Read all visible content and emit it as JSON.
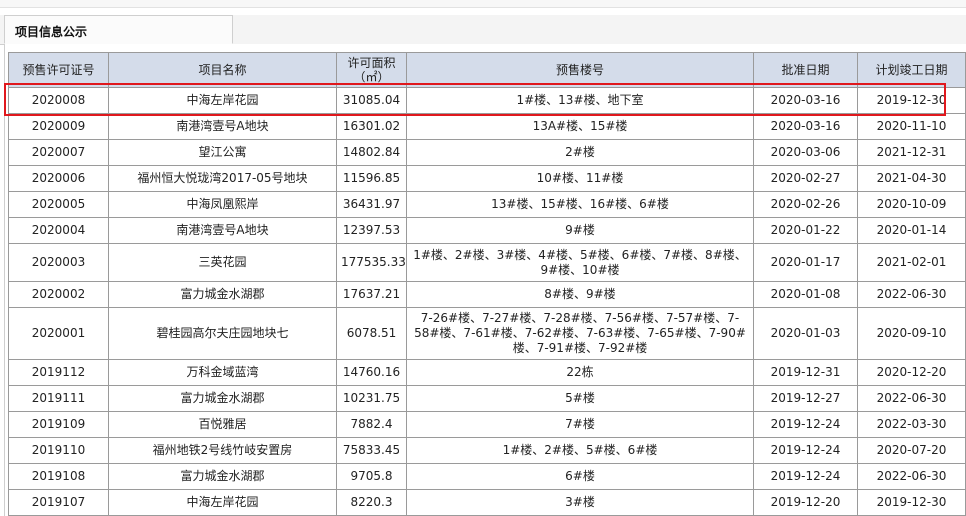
{
  "tab": {
    "label": "项目信息公示"
  },
  "table": {
    "headers": [
      "预售许可证号",
      "项目名称",
      "许可面积（㎡）",
      "预售楼号",
      "批准日期",
      "计划竣工日期"
    ],
    "rows": [
      [
        "2020008",
        "中海左岸花园",
        "31085.04",
        "1#楼、13#楼、地下室",
        "2020-03-16",
        "2019-12-30"
      ],
      [
        "2020009",
        "南港湾壹号A地块",
        "16301.02",
        "13A#楼、15#楼",
        "2020-03-16",
        "2020-11-10"
      ],
      [
        "2020007",
        "望江公寓",
        "14802.84",
        "2#楼",
        "2020-03-06",
        "2021-12-31"
      ],
      [
        "2020006",
        "福州恒大悦珑湾2017-05号地块",
        "11596.85",
        "10#楼、11#楼",
        "2020-02-27",
        "2021-04-30"
      ],
      [
        "2020005",
        "中海凤凰熙岸",
        "36431.97",
        "13#楼、15#楼、16#楼、6#楼",
        "2020-02-26",
        "2020-10-09"
      ],
      [
        "2020004",
        "南港湾壹号A地块",
        "12397.53",
        "9#楼",
        "2020-01-22",
        "2020-01-14"
      ],
      [
        "2020003",
        "三英花园",
        "177535.33",
        "1#楼、2#楼、3#楼、4#楼、5#楼、6#楼、7#楼、8#楼、9#楼、10#楼",
        "2020-01-17",
        "2021-02-01"
      ],
      [
        "2020002",
        "富力城金水湖郡",
        "17637.21",
        "8#楼、9#楼",
        "2020-01-08",
        "2022-06-30"
      ],
      [
        "2020001",
        "碧桂园高尔夫庄园地块七",
        "6078.51",
        "7-26#楼、7-27#楼、7-28#楼、7-56#楼、7-57#楼、7-58#楼、7-61#楼、7-62#楼、7-63#楼、7-65#楼、7-90#楼、7-91#楼、7-92#楼",
        "2020-01-03",
        "2020-09-10"
      ],
      [
        "2019112",
        "万科金域蓝湾",
        "14760.16",
        "22栋",
        "2019-12-31",
        "2020-12-20"
      ],
      [
        "2019111",
        "富力城金水湖郡",
        "10231.75",
        "5#楼",
        "2019-12-27",
        "2022-06-30"
      ],
      [
        "2019109",
        "百悦雅居",
        "7882.4",
        "7#楼",
        "2019-12-24",
        "2022-03-30"
      ],
      [
        "2019110",
        "福州地铁2号线竹岐安置房",
        "75833.45",
        "1#楼、2#楼、5#楼、6#楼",
        "2019-12-24",
        "2020-07-20"
      ],
      [
        "2019108",
        "富力城金水湖郡",
        "9705.8",
        "6#楼",
        "2019-12-24",
        "2022-06-30"
      ],
      [
        "2019107",
        "中海左岸花园",
        "8220.3",
        "3#楼",
        "2019-12-20",
        "2019-12-30"
      ]
    ]
  },
  "highlight_color": "#e0181d"
}
